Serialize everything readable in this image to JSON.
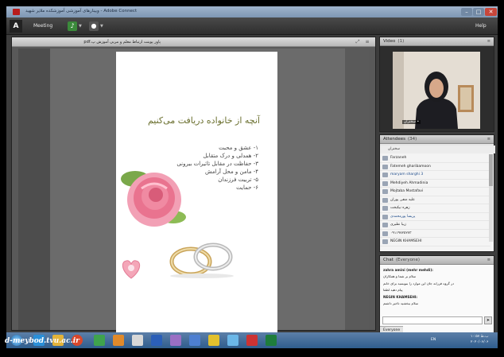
{
  "window": {
    "title": "وبینارهای آموزشی آموزشکده ملایر شهید - Adobe Connect"
  },
  "menu": {
    "meeting": "Meeting",
    "help": "Help"
  },
  "share_pod": {
    "title": "پاور پوینت ارتباط معلم و مربی آموزش پ.pdf"
  },
  "slide": {
    "title": "آنچه از خانواده دریافت می‌کنیم",
    "items": [
      "۱- عشق و محبت",
      "۲- همدلی و درک متقابل",
      "۳- حفاظت در مقابل تاثیرات بیرونی",
      "۴- مامن و محل آرامش",
      "۵- تربیت فرزندان",
      "۶- حمایت"
    ]
  },
  "video_pod": {
    "title": "Video",
    "count": "(1)",
    "caller_name": "• سخنران"
  },
  "attendees_pod": {
    "title": "Attendees",
    "count": "(34)",
    "section_label": "سخنران",
    "items": [
      "Farzaneh",
      "Fatemeh gharibamoon",
      "maryam sharghi 3",
      "Mehdiyeh Ahmadinia",
      "Mojtaba Mostafavi",
      "علیه منفی پوران",
      "زهره نیکبخت",
      "پریسا پورمحمدی",
      "زیبا نظیری",
      "٠٩١١٩٧٢٥٢٧٣",
      "NEGIN KHAMSEHI"
    ]
  },
  "chat_pod": {
    "title": "Chat",
    "count": "(Everyone)",
    "messages": [
      {
        "name": "zahra amini (mehr mehdi):",
        "text": "سلام بر شما و همکاران"
      },
      {
        "name": "",
        "text": "در گروه فرزانه جان این موارد را بنویسید برای خانم"
      },
      {
        "name": "",
        "text": "پیام دهید لطفا"
      },
      {
        "name": "NEGIN KHAMSEHI:",
        "text": "سلام ببخشید تاخیر داشتم"
      }
    ],
    "tab_label": "Everyone"
  },
  "taskbar": {
    "language": "EN",
    "time": "۱۰:۵۷ ب.ظ",
    "date": "۲۰۲۰/۰۶/۰۶"
  },
  "watermark": "d-meybod.tvu.ac.ir",
  "colors": {
    "title_bar": "#8ea6c2",
    "menu_bar": "#3a3a3a",
    "slide_title": "#6a6f2e",
    "taskbar": "#3f6a99"
  }
}
